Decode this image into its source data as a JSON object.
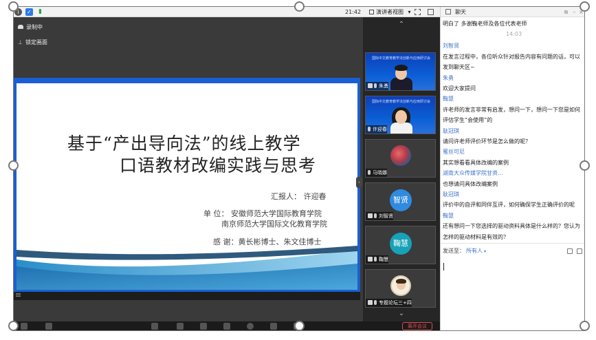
{
  "topbar": {
    "time": "21:42",
    "view_label": "演讲者视图",
    "view_caret": "▾"
  },
  "stage": {
    "recording_label": "录制中",
    "pin_label": "锁定画面"
  },
  "slide": {
    "title_line1": "基于“产出导向法”的线上教学",
    "title_line2": "口语教材改编实践与思考",
    "reporter": "汇报人： 许迎春",
    "unit_line1": "单  位： 安徽师范大学国际教育学院",
    "unit_line2": "南京师范大学国际文化教育学院",
    "thanks": "感    谢：黄长彬博士、朱文佳博士"
  },
  "participants": {
    "scroll_up": "⌃",
    "scroll_down": "⌄",
    "tiles": [
      {
        "name": "朱勇",
        "type": "video",
        "banner": "国际中文教育教学法创新与应用研讨会"
      },
      {
        "name": "许迎春",
        "type": "video",
        "banner": "国际中文教育教学法创新与应用研讨会"
      },
      {
        "name": "马晓娜",
        "type": "photo"
      },
      {
        "name": "刘智贤",
        "type": "avatar",
        "avatar_text": "智贤",
        "avatar_color": "#2f8be0"
      },
      {
        "name": "鞠慧",
        "type": "avatar",
        "avatar_text": "鞠慧",
        "avatar_color": "#17a2b8"
      },
      {
        "name": "专题论坛三+四",
        "type": "photo"
      }
    ]
  },
  "bottombar": {
    "leave_label": "离开会议"
  },
  "chat": {
    "title": "聊天",
    "messages": [
      {
        "kind": "text",
        "text": "明白了 多谢鞠老师及各位代表老师"
      },
      {
        "kind": "time",
        "text": "14:03"
      },
      {
        "kind": "name",
        "text": "刘智贤"
      },
      {
        "kind": "text",
        "text": "在发言过程中，各位听众针对报告内容有问题的话，可以"
      },
      {
        "kind": "text",
        "text": "发到聊天区~"
      },
      {
        "kind": "name",
        "text": "朱勇"
      },
      {
        "kind": "text",
        "text": "欢迎大家提问"
      },
      {
        "kind": "name",
        "text": "鞠慧"
      },
      {
        "kind": "text",
        "text": "许老师的发言非常有启发，想问一下，想问一下您是如何"
      },
      {
        "kind": "text",
        "text": "评估学生“会使用”的"
      },
      {
        "kind": "name",
        "text": "耿冠琪"
      },
      {
        "kind": "text",
        "text": "请问许老师评价环节是怎么做的呢？"
      },
      {
        "kind": "name",
        "text": "蜜丝可尼"
      },
      {
        "kind": "text",
        "text": "其实想看看具体改编的案例"
      },
      {
        "kind": "name",
        "text": "湖南大众传媒学院甘资..."
      },
      {
        "kind": "text",
        "text": "也想请问具体改编案例"
      },
      {
        "kind": "name",
        "text": "耿冠琪"
      },
      {
        "kind": "text",
        "text": "评价中的自评和同伴互评，如何确保学生正确评价的呢"
      },
      {
        "kind": "name",
        "text": "鞠慧"
      },
      {
        "kind": "text",
        "text": "还有想问一下您选择的驱动资料具体是什么样的？您认为"
      },
      {
        "kind": "text",
        "text": "怎样的驱动材料是有效的？"
      }
    ],
    "send_to_label": "发送至：",
    "send_target": "所有人",
    "send_caret": "▾"
  },
  "colors": {
    "slide_border": "#1a5fd1",
    "chat_name": "#3f74c9",
    "leave": "#e05050"
  }
}
